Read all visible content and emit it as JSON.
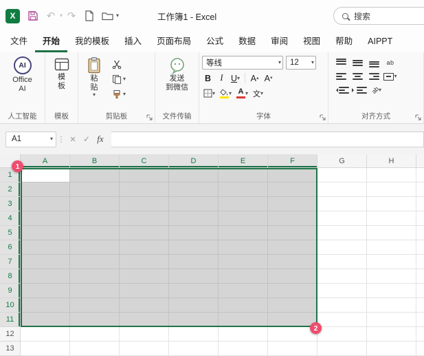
{
  "title_bar": {
    "title": "工作簿1 - Excel",
    "search": "搜索"
  },
  "tabs": {
    "active_index": 1,
    "items": [
      "文件",
      "开始",
      "我的模板",
      "插入",
      "页面布局",
      "公式",
      "数据",
      "审阅",
      "视图",
      "帮助",
      "AIPPT"
    ]
  },
  "groups": {
    "ai": {
      "icon_text": "AI",
      "line1": "Office",
      "line2": "AI",
      "group": "人工智能"
    },
    "template": {
      "line1": "模",
      "line2": "板",
      "group": "模板"
    },
    "clipboard": {
      "paste1": "粘",
      "paste2": "贴",
      "group": "剪贴板"
    },
    "transfer": {
      "line1": "发送",
      "line2": "到微信",
      "group": "文件传输"
    },
    "font": {
      "name": "等线",
      "size": "12",
      "bold": "B",
      "italic": "I",
      "underline": "U",
      "grow": "A",
      "shrink": "A",
      "color": "A",
      "phonetic": "文",
      "group": "字体"
    },
    "align": {
      "wrap": "ab",
      "orient": "ab",
      "group": "对齐方式"
    }
  },
  "formula_bar": {
    "name_box": "A1",
    "fx": "fx",
    "value": ""
  },
  "grid": {
    "columns": [
      "A",
      "B",
      "C",
      "D",
      "E",
      "F",
      "G",
      "H"
    ],
    "rows": [
      "1",
      "2",
      "3",
      "4",
      "5",
      "6",
      "7",
      "8",
      "9",
      "10",
      "11",
      "12",
      "13"
    ],
    "selected_col_count": 6,
    "selected_row_count": 11,
    "active_cell": "A1",
    "selection": "A1:F11"
  },
  "badges": {
    "one": "1",
    "two": "2"
  },
  "colors": {
    "accent_green": "#107C41",
    "selection_border": "#1f7246",
    "badge_pink": "#ee4d6e",
    "fill_yellow": "#ffe312",
    "font_red": "#d83b2d"
  }
}
